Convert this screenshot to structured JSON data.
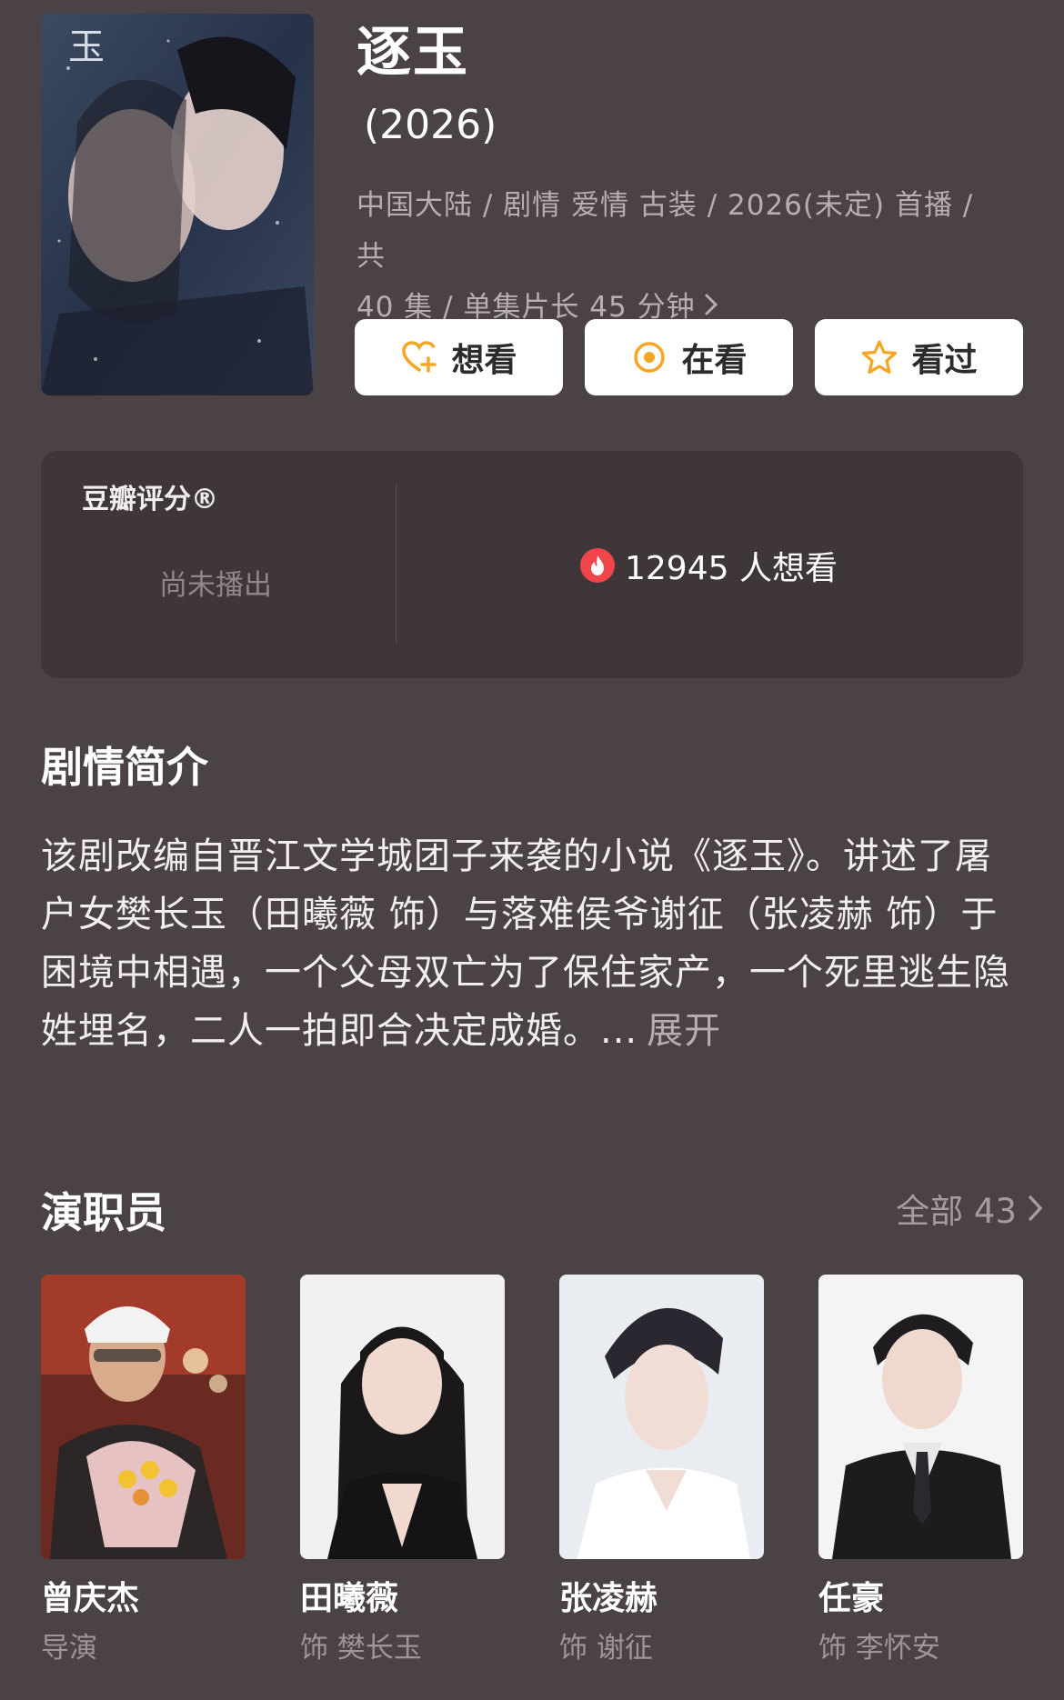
{
  "show": {
    "title": "逐玉",
    "year": "(2026)",
    "meta_line1": "中国大陆 / 剧情 爱情 古装 / 2026(未定) 首播 / 共",
    "meta_line2": "40 集 / 单集片长 45 分钟"
  },
  "actions": [
    {
      "label": "想看",
      "icon": "heart-plus-icon"
    },
    {
      "label": "在看",
      "icon": "target-icon"
    },
    {
      "label": "看过",
      "icon": "star-icon"
    }
  ],
  "rating": {
    "label": "豆瓣评分®",
    "status": "尚未播出",
    "wish_count_text": "12945 人想看"
  },
  "synopsis": {
    "heading": "剧情简介",
    "text": "该剧改编自晋江文学城团子来袭的小说《逐玉》。讲述了屠户女樊长玉（田曦薇 饰）与落难侯爷谢征（张凌赫 饰）于困境中相遇，一个父母双亡为了保住家产，一个死里逃生隐姓埋名，二人一拍即合决定成婚。...",
    "more_label": "展开"
  },
  "cast": {
    "heading": "演职员",
    "all_label": "全部 43",
    "members": [
      {
        "name": "曾庆杰",
        "role": "导演"
      },
      {
        "name": "田曦薇",
        "role": "饰 樊长玉"
      },
      {
        "name": "张凌赫",
        "role": "饰 谢征"
      },
      {
        "name": "任豪",
        "role": "饰 李怀安"
      }
    ]
  },
  "colors": {
    "background": "#4a4245",
    "card": "#3f3639",
    "accent_orange": "#f5a623",
    "flame_red": "#f0454a"
  }
}
